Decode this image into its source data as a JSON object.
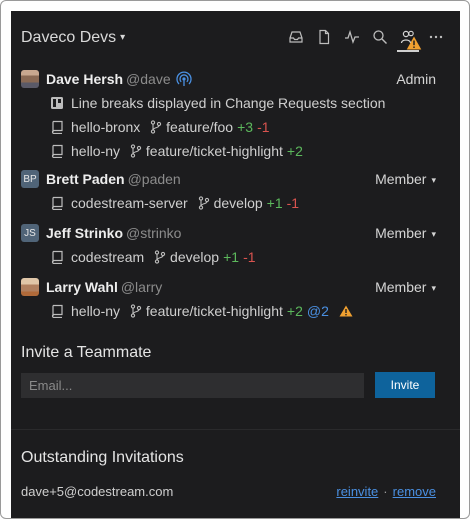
{
  "header": {
    "team_name": "Daveco Devs",
    "icons": [
      "inbox-icon",
      "file-icon",
      "activity-icon",
      "search-icon",
      "team-icon",
      "more-icon"
    ]
  },
  "members": [
    {
      "name": "Dave Hersh",
      "handle": "@dave",
      "role": "Admin",
      "rows": [
        {
          "kind": "review",
          "text": "Line breaks displayed in Change Requests section"
        },
        {
          "kind": "repo",
          "repo": "hello-bronx",
          "branch": "feature/foo",
          "add": "+3",
          "del": "-1"
        },
        {
          "kind": "repo",
          "repo": "hello-ny",
          "branch": "feature/ticket-highlight",
          "add": "+2"
        }
      ]
    },
    {
      "name": "Brett Paden",
      "handle": "@paden",
      "initials": "BP",
      "role": "Member",
      "rows": [
        {
          "kind": "repo",
          "repo": "codestream-server",
          "branch": "develop",
          "add": "+1",
          "del": "-1"
        }
      ]
    },
    {
      "name": "Jeff Strinko",
      "handle": "@strinko",
      "initials": "JS",
      "role": "Member",
      "rows": [
        {
          "kind": "repo",
          "repo": "codestream",
          "branch": "develop",
          "add": "+1",
          "del": "-1"
        }
      ]
    },
    {
      "name": "Larry Wahl",
      "handle": "@larry",
      "role": "Member",
      "rows": [
        {
          "kind": "repo",
          "repo": "hello-ny",
          "branch": "feature/ticket-highlight",
          "add": "+2",
          "mention": "@2"
        }
      ]
    }
  ],
  "invite": {
    "title": "Invite a Teammate",
    "placeholder": "Email...",
    "button_label": "Invite"
  },
  "outstanding": {
    "title": "Outstanding Invitations",
    "email": "dave+5@codestream.com",
    "reinvite_label": "reinvite",
    "separator": "·",
    "remove_label": "remove"
  },
  "colors": {
    "panel_bg": "#1c1c1e",
    "added": "#5cb85c",
    "deleted": "#d9534f",
    "link": "#4a90e2",
    "button": "#0e639c",
    "warning": "#f0a030"
  }
}
